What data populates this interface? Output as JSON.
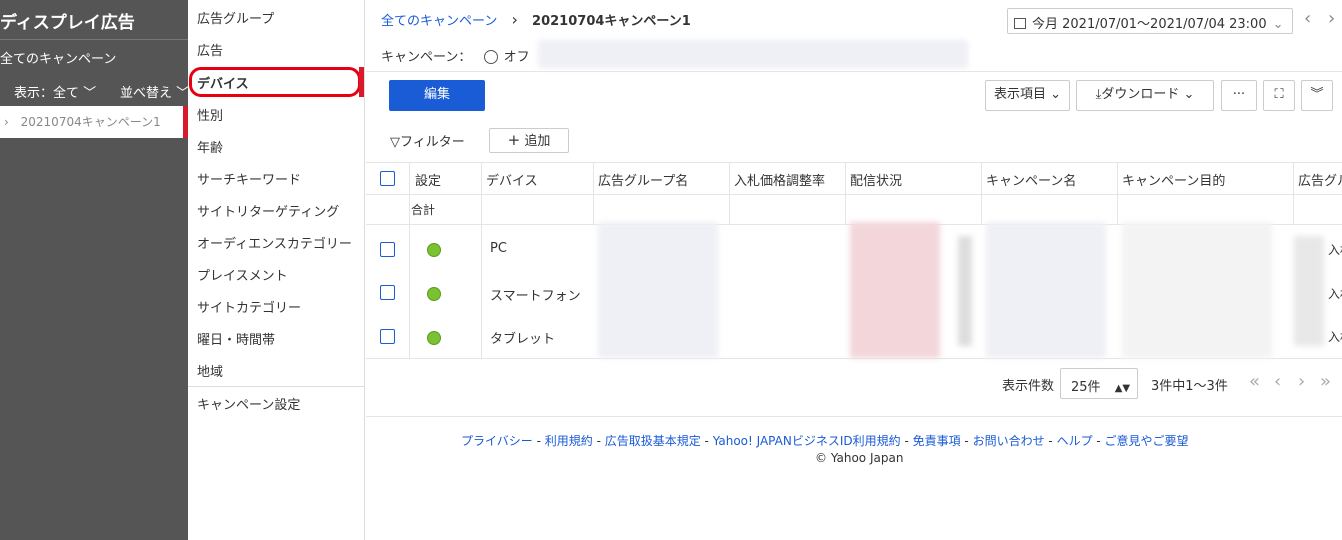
{
  "sidebar": {
    "title": "ディスプレイ広告",
    "all_campaigns": "全てのキャンペーン",
    "view_label": "表示：全て",
    "sort_label": "並べ替え",
    "campaign_item": "20210704キャンペーン1"
  },
  "submenu": {
    "items": [
      "広告グループ",
      "広告",
      "デバイス",
      "性別",
      "年齢",
      "サーチキーワード",
      "サイトリターゲティング",
      "オーディエンスカテゴリー",
      "プレイスメント",
      "サイトカテゴリー",
      "曜日・時間帯",
      "地域"
    ],
    "settings": "キャンペーン設定",
    "active": "デバイス"
  },
  "header": {
    "breadcrumb_root": "全てのキャンペーン",
    "breadcrumb_sep": "›",
    "breadcrumb_current": "20210704キャンペーン1",
    "date_range": "今月 2021/07/01〜2021/07/04 23:00",
    "campaign_label": "キャンペーン：",
    "campaign_status": "オフ"
  },
  "toolbar": {
    "edit": "編集",
    "display_items": "表示項目",
    "download": "ダウンロード",
    "more": "···",
    "filter": "フィルター",
    "add": "追加"
  },
  "table": {
    "headers": [
      "設定",
      "デバイス",
      "広告グループ名",
      "入札価格調整率",
      "配信状況",
      "キャンペーン名",
      "キャンペーン目的",
      "広告グル"
    ],
    "total_label": "合計",
    "rows": [
      {
        "device": "PC"
      },
      {
        "device": "スマートフォン"
      },
      {
        "device": "タブレット"
      }
    ],
    "partial_cell": "入札"
  },
  "pagination": {
    "per_page_label": "表示件数",
    "per_page_value": "25件",
    "range": "3件中1〜3件"
  },
  "footer": {
    "links": [
      "プライバシー",
      "利用規約",
      "広告取扱基本規定",
      "Yahoo! JAPANビジネスID利用規約",
      "免責事項",
      "お問い合わせ",
      "ヘルプ",
      "ご意見やご要望"
    ],
    "copyright": "© Yahoo Japan"
  },
  "colors": {
    "accent": "#1a5bd6",
    "sidebar": "#555555",
    "highlight": "#e60012",
    "status_on": "#7bc232"
  }
}
